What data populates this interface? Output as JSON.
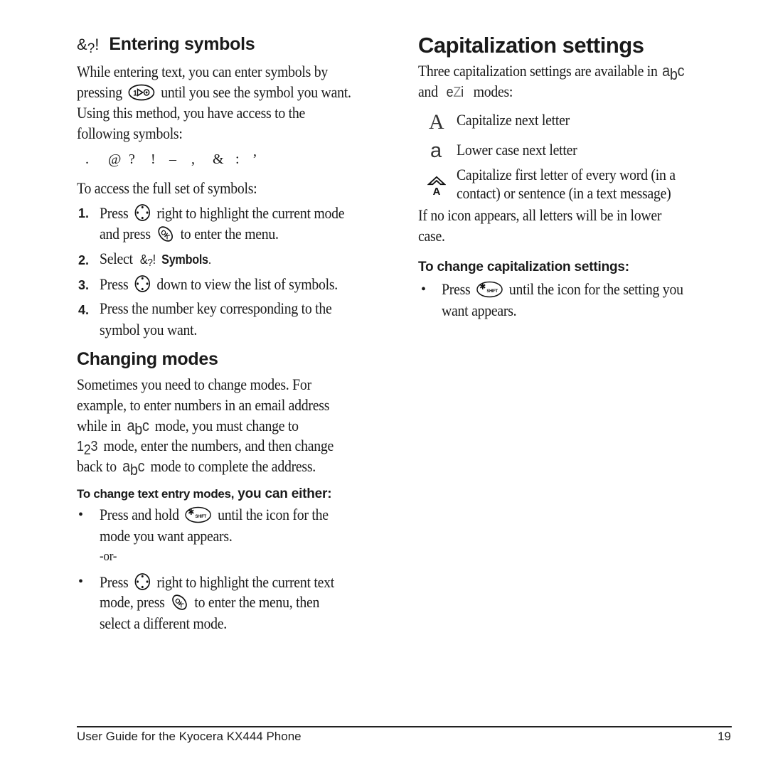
{
  "left": {
    "entering_symbols": {
      "icon_label": "&?!",
      "title": "Entering symbols",
      "para_lines": [
        "While entering text, you can enter symbols by",
        "pressing",
        "until you see the symbol you want.",
        "Using this method, you have access to the",
        "following symbols:"
      ],
      "symbols": [
        ".",
        "@",
        "?",
        "!",
        "–",
        ",",
        "&",
        ":",
        "’"
      ],
      "access_intro": "To access the full set of symbols:",
      "steps": [
        {
          "num": "1.",
          "a": "Press",
          "b": "right to highlight the current mode",
          "c": "and press",
          "d": "to enter the menu."
        },
        {
          "num": "2.",
          "a": "Select",
          "icon": "&?!",
          "bold": "Symbols",
          "end": "."
        },
        {
          "num": "3.",
          "a": "Press",
          "b": "down to view the list of symbols."
        },
        {
          "num": "4.",
          "a": "Press the number key corresponding to the",
          "b": "symbol you want."
        }
      ]
    },
    "changing_modes": {
      "title": "Changing modes",
      "para": {
        "l1": "Sometimes you need to change modes. For",
        "l2": "example, to enter numbers in an email address",
        "l3a": "while in",
        "l3b": "mode, you must change to",
        "l4": "mode, enter the numbers, and then change",
        "l5a": "back to",
        "l5b": "mode to complete the address."
      },
      "mode_abc": "abc",
      "mode_123": "123",
      "subheading_a": "To change text entry modes,",
      "subheading_b": " you can either:",
      "bullets": [
        {
          "a": "Press and hold",
          "b": "until the icon for the",
          "c": "mode you want appears."
        },
        {
          "a": "Press",
          "b": "right to highlight the current text",
          "c": "mode, press",
          "d": "to enter the menu, then",
          "e": "select a different mode."
        }
      ],
      "or_label": "-or-"
    }
  },
  "right": {
    "title": "Capitalization settings",
    "intro_a": "Three capitalization settings are available in",
    "intro_b": "and",
    "intro_c": "modes:",
    "mode_abc": "abc",
    "mode_ezi": "eZi",
    "settings": [
      {
        "icon": "A",
        "label": "Capitalize next letter"
      },
      {
        "icon": "a",
        "label": "Lower case next letter"
      },
      {
        "icon": "shift-A",
        "label_l1": "Capitalize first letter of every word (in a",
        "label_l2": "contact) or sentence (in a text message)"
      }
    ],
    "note_l1": "If no icon appears, all letters will be in lower",
    "note_l2": "case.",
    "subheading": "To change capitalization settings:",
    "bullet": {
      "a": "Press",
      "b": "until the icon for the setting you",
      "c": "want appears."
    }
  },
  "footer": {
    "title": "User Guide for the Kyocera KX444 Phone",
    "page": "19"
  },
  "icons": {
    "symbol_key": "1&@ key",
    "nav_key": "navigation key",
    "ok_key": "OK",
    "shift_key": "SHIFT",
    "shift_star": "✱"
  }
}
